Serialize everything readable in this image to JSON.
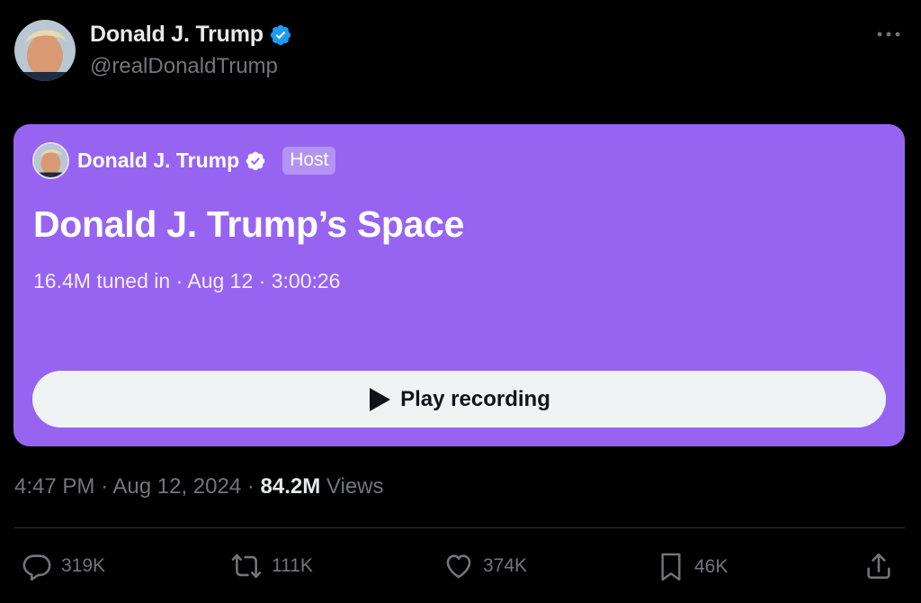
{
  "author": {
    "name": "Donald J. Trump",
    "handle": "@realDonaldTrump",
    "verified_icon": "verified-badge-icon",
    "avatar_icon": "avatar"
  },
  "space": {
    "host_name": "Donald J. Trump",
    "host_label": "Host",
    "title": "Donald J. Trump’s Space",
    "listeners": "16.4M tuned in",
    "date": "Aug 12",
    "duration": "3:00:26",
    "play_label": "Play recording",
    "card_color": "#9664f1"
  },
  "post": {
    "time": "4:47 PM",
    "date": "Aug 12, 2024",
    "views_count": "84.2M",
    "views_label": "Views",
    "separator": "·"
  },
  "actions": {
    "replies": "319K",
    "reposts": "111K",
    "likes": "374K",
    "bookmarks": "46K"
  },
  "colors": {
    "background": "#000000",
    "verified": "#1d9bf0",
    "muted_text": "#71767b"
  }
}
